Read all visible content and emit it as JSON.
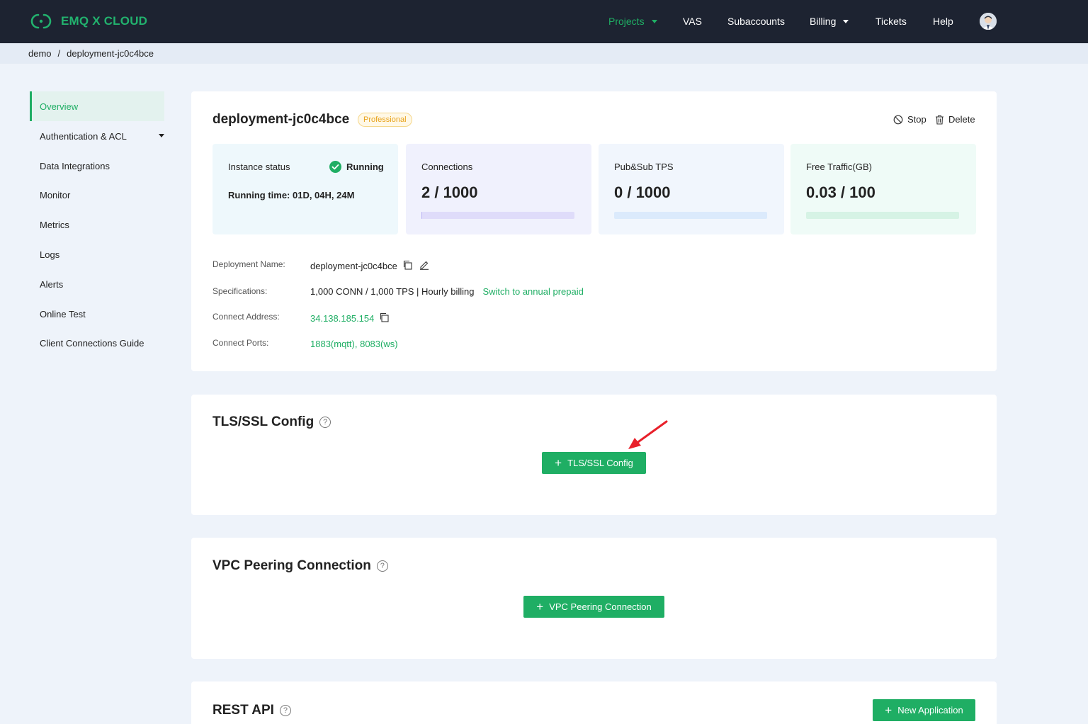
{
  "header": {
    "logo_text": "EMQ X CLOUD",
    "nav": [
      "Projects",
      "VAS",
      "Subaccounts",
      "Billing",
      "Tickets",
      "Help"
    ]
  },
  "breadcrumb": {
    "items": [
      "demo",
      "deployment-jc0c4bce"
    ],
    "separator": "/"
  },
  "sidebar": {
    "items": [
      "Overview",
      "Authentication & ACL",
      "Data Integrations",
      "Monitor",
      "Metrics",
      "Logs",
      "Alerts",
      "Online Test",
      "Client Connections Guide"
    ]
  },
  "deployment": {
    "name": "deployment-jc0c4bce",
    "plan_badge": "Professional",
    "stop_label": "Stop",
    "delete_label": "Delete"
  },
  "stats": {
    "status_label": "Instance status",
    "status_value": "Running",
    "running_time": "Running time: 01D, 04H, 24M",
    "connections_label": "Connections",
    "connections_value": "2 / 1000",
    "connections_fraction": 0.002,
    "tps_label": "Pub&Sub TPS",
    "tps_value": "0 / 1000",
    "tps_fraction": 0.0,
    "traffic_label": "Free Traffic(GB)",
    "traffic_value": "0.03 / 100",
    "traffic_fraction": 0.0003
  },
  "info": {
    "name_label": "Deployment Name:",
    "name_value": "deployment-jc0c4bce",
    "spec_label": "Specifications:",
    "spec_value": "1,000 CONN / 1,000 TPS | Hourly billing",
    "spec_link": "Switch to annual prepaid",
    "address_label": "Connect Address:",
    "address_value": "34.138.185.154",
    "ports_label": "Connect Ports:",
    "ports_value": "1883(mqtt), 8083(ws)"
  },
  "tls": {
    "title": "TLS/SSL Config",
    "button": "TLS/SSL Config"
  },
  "vpc": {
    "title": "VPC Peering Connection",
    "button": "VPC Peering Connection"
  },
  "rest": {
    "title": "REST API",
    "button": "New Application"
  },
  "colors": {
    "accent": "#1fae64",
    "nav_bg": "#1d2331",
    "badge": "#e8a21a",
    "arrow": "#e8202a"
  },
  "icons": [
    "logo-icon",
    "caret-down-icon",
    "avatar-icon",
    "stop-icon",
    "trash-icon",
    "check-circle-icon",
    "copy-icon",
    "edit-icon",
    "help-icon",
    "plus-icon",
    "arrow-annotation-icon"
  ]
}
